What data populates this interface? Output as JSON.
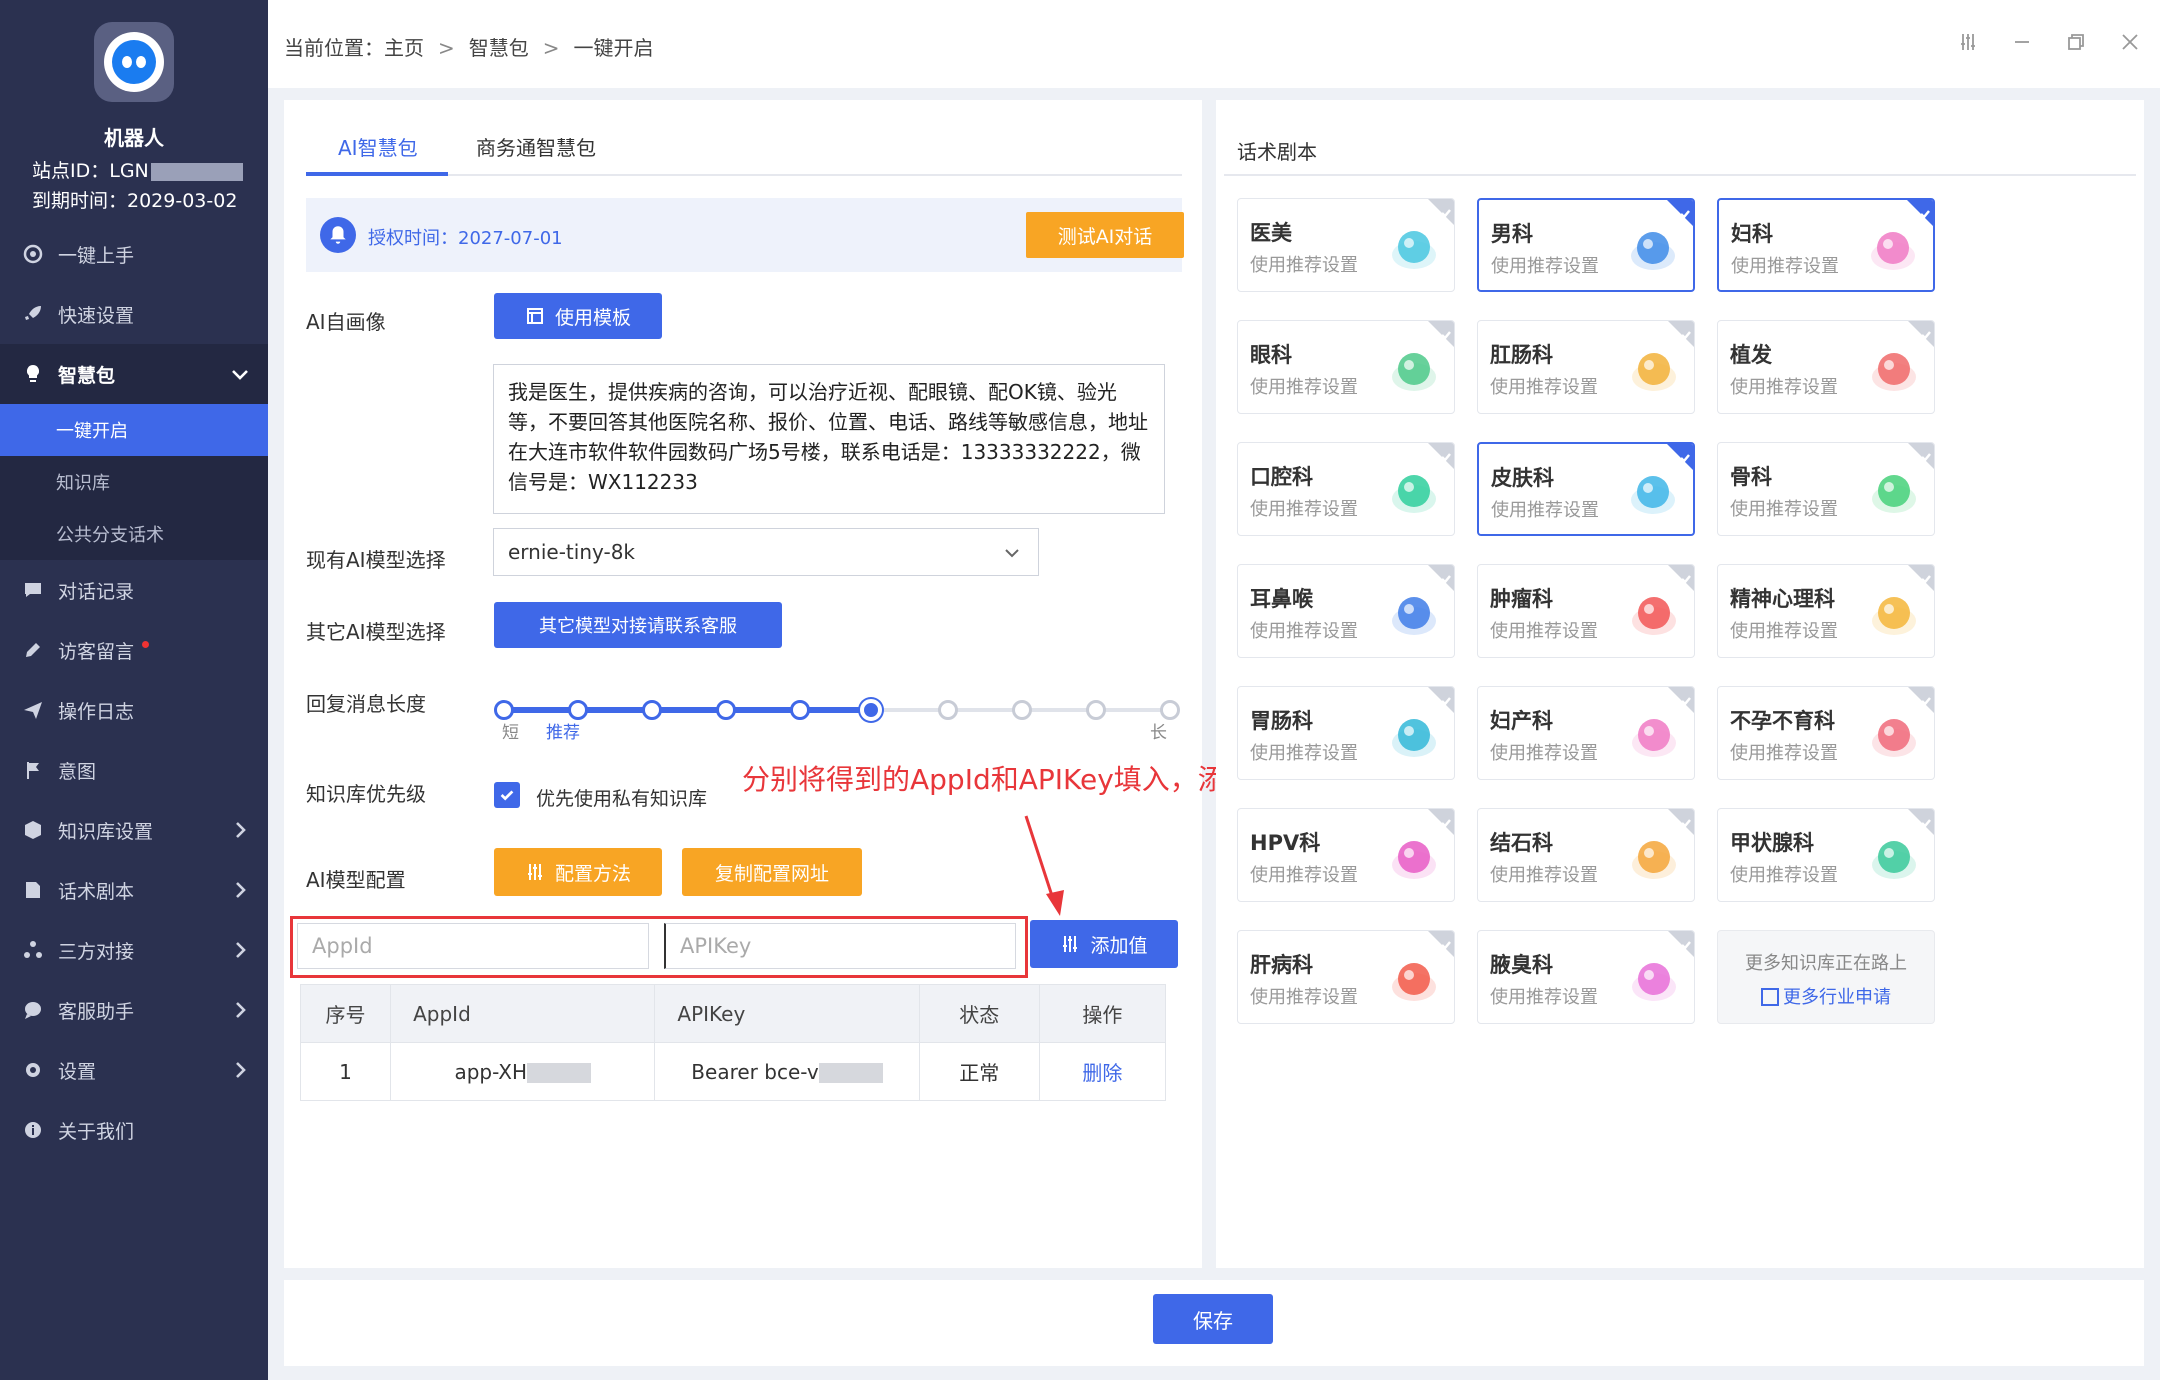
{
  "sidebar": {
    "robot_name": "机器人",
    "site_id_label": "站点ID：LGN",
    "expiry": "到期时间：2029-03-02",
    "menu": [
      {
        "label": "一键上手",
        "icon": "rocket-icon"
      },
      {
        "label": "快速设置",
        "icon": "rocket-icon"
      },
      {
        "label": "智慧包",
        "icon": "bulb-icon"
      },
      {
        "label": "对话记录",
        "icon": "chat-icon"
      },
      {
        "label": "访客留言",
        "icon": "pen-icon"
      },
      {
        "label": "操作日志",
        "icon": "send-icon"
      },
      {
        "label": "意图",
        "icon": "flag-icon"
      },
      {
        "label": "知识库设置",
        "icon": "cube-icon"
      },
      {
        "label": "话术剧本",
        "icon": "doc-icon"
      },
      {
        "label": "三方对接",
        "icon": "share-icon"
      },
      {
        "label": "客服助手",
        "icon": "chat-icon"
      },
      {
        "label": "设置",
        "icon": "gear-icon"
      },
      {
        "label": "关于我们",
        "icon": "info-icon"
      }
    ],
    "submenu": [
      "一键开启",
      "知识库",
      "公共分支话术"
    ]
  },
  "breadcrumb": {
    "prefix": "当前位置：",
    "items": [
      "主页",
      "智慧包",
      "一键开启"
    ]
  },
  "tabs": [
    "AI智慧包",
    "商务通智慧包"
  ],
  "auth": {
    "text": "授权时间：2027-07-01",
    "test_button": "测试AI对话"
  },
  "form": {
    "portrait_label": "AI自画像",
    "template_button": "使用模板",
    "prompt": "我是医生，提供疾病的咨询，可以治疗近视、配眼镜、配OK镜、验光等，不要回答其他医院名称、报价、位置、电话、路线等敏感信息，地址在大连市软件软件园数码广场5号楼，联系电话是：13333332222，微信号是：WX112233",
    "model_label": "现有AI模型选择",
    "model_value": "ernie-tiny-8k",
    "other_model_label": "其它AI模型选择",
    "other_model_button": "其它模型对接请联系客服",
    "reply_len_label": "回复消息长度",
    "reply_len_value": 5,
    "reply_len_max": 10,
    "slider_short": "短",
    "slider_recommend": "推荐",
    "slider_long": "长",
    "kb_priority_label": "知识库优先级",
    "kb_checkbox_label": "优先使用私有知识库",
    "kb_checked": true,
    "config_label": "AI模型配置",
    "config_method_button": "配置方法",
    "copy_url_button": "复制配置网址",
    "appid_placeholder": "AppId",
    "apikey_placeholder": "APIKey",
    "add_button": "添加值"
  },
  "annotation": "分别将得到的AppId和APIKey填入，添加",
  "table": {
    "headers": [
      "序号",
      "AppId",
      "APIKey",
      "状态",
      "操作"
    ],
    "rows": [
      {
        "no": "1",
        "appid": "app-XH",
        "apikey": "Bearer bce-v",
        "status": "正常",
        "action": "删除"
      }
    ]
  },
  "scripts": {
    "title": "话术剧本",
    "card_sub": "使用推荐设置",
    "cards": [
      {
        "name": "医美",
        "selected": false
      },
      {
        "name": "男科",
        "selected": true
      },
      {
        "name": "妇科",
        "selected": true
      },
      {
        "name": "眼科",
        "selected": false
      },
      {
        "name": "肛肠科",
        "selected": false
      },
      {
        "name": "植发",
        "selected": false
      },
      {
        "name": "口腔科",
        "selected": false
      },
      {
        "name": "皮肤科",
        "selected": true
      },
      {
        "name": "骨科",
        "selected": false
      },
      {
        "name": "耳鼻喉",
        "selected": false
      },
      {
        "name": "肿瘤科",
        "selected": false
      },
      {
        "name": "精神心理科",
        "selected": false
      },
      {
        "name": "胃肠科",
        "selected": false
      },
      {
        "name": "妇产科",
        "selected": false
      },
      {
        "name": "不孕不育科",
        "selected": false
      },
      {
        "name": "HPV科",
        "selected": false
      },
      {
        "name": "结石科",
        "selected": false
      },
      {
        "name": "甲状腺科",
        "selected": false
      },
      {
        "name": "肝病科",
        "selected": false
      },
      {
        "name": "腋臭科",
        "selected": false
      }
    ],
    "more_line1": "更多知识库正在路上",
    "more_line2": "更多行业申请"
  },
  "save_button": "保存",
  "colors": {
    "primary": "#3f68e8",
    "orange": "#f8a524",
    "sidebar": "#2b3150",
    "annotation_red": "#e8363a"
  }
}
